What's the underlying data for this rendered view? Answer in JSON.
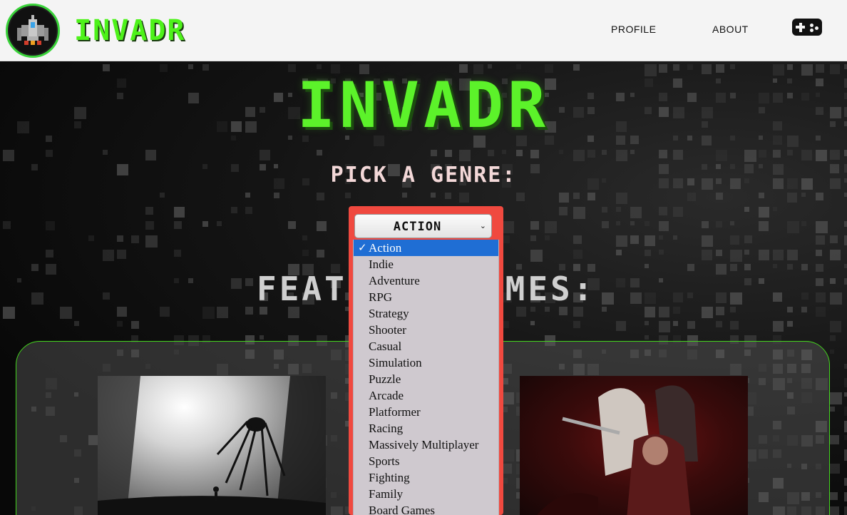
{
  "navbar": {
    "brand": "INVADR",
    "links": [
      {
        "label": "PROFILE"
      },
      {
        "label": "ABOUT"
      }
    ],
    "gamepad_icon": "gamepad-icon",
    "logo_icon": "spaceship-logo-icon"
  },
  "hero": {
    "title": "INVADR",
    "pick_label": "PICK A GENRE:",
    "featured_label": "FEATURED GAMES:"
  },
  "genre_select": {
    "selected_value": "ACTION",
    "options": [
      "Action",
      "Indie",
      "Adventure",
      "RPG",
      "Strategy",
      "Shooter",
      "Casual",
      "Simulation",
      "Puzzle",
      "Arcade",
      "Platformer",
      "Racing",
      "Massively Multiplayer",
      "Sports",
      "Fighting",
      "Family",
      "Board Games"
    ],
    "selected_index": 0
  },
  "colors": {
    "brand_green": "#4ef21a",
    "highlight_red": "#f0493f",
    "option_selected_blue": "#1f6ed4",
    "panel_border_green": "#44d61e"
  }
}
